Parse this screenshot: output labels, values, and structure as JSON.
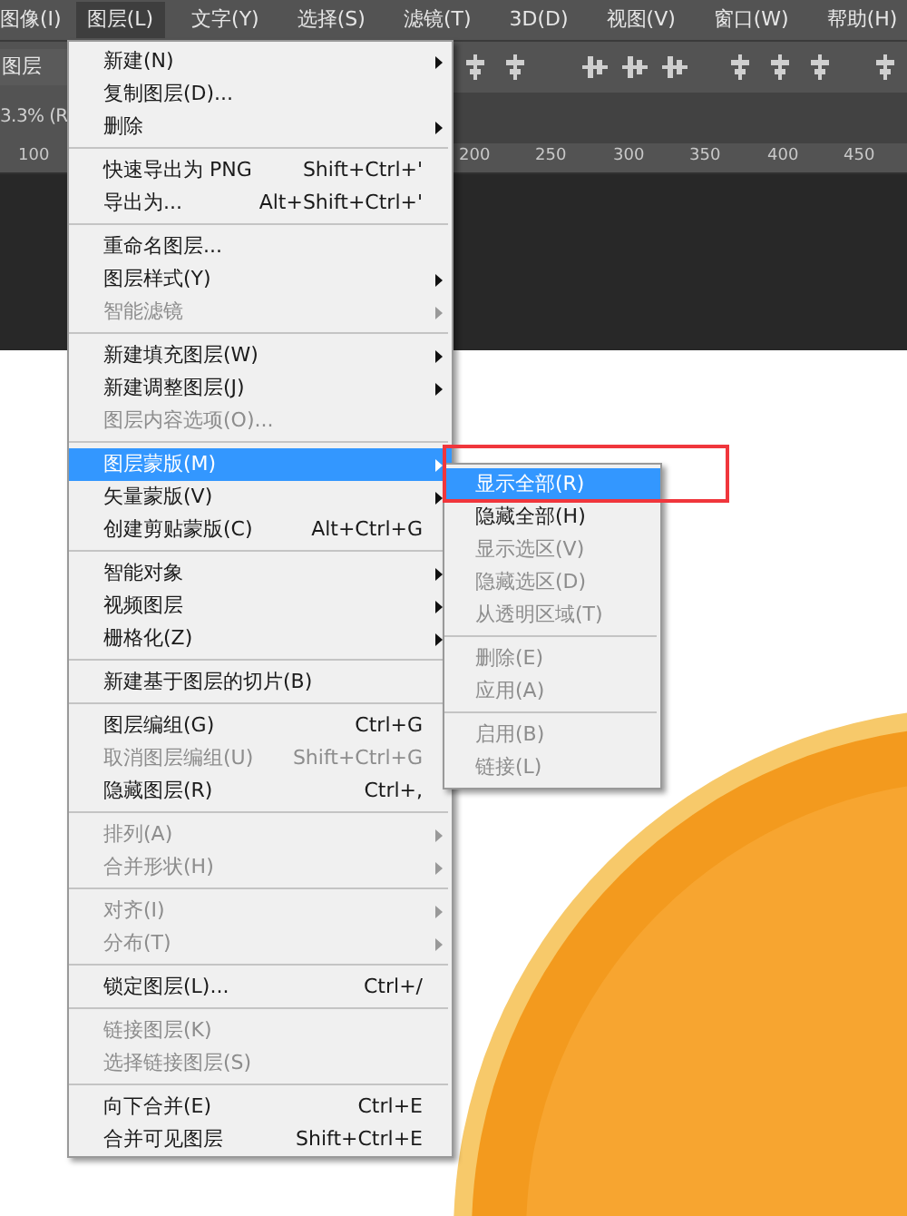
{
  "menubar": [
    {
      "label": "图像(I)",
      "selected": false
    },
    {
      "label": "图层(L)",
      "selected": true
    },
    {
      "label": "文字(Y)",
      "selected": false
    },
    {
      "label": "选择(S)",
      "selected": false
    },
    {
      "label": "滤镜(T)",
      "selected": false
    },
    {
      "label": "3D(D)",
      "selected": false
    },
    {
      "label": "视图(V)",
      "selected": false
    },
    {
      "label": "窗口(W)",
      "selected": false
    },
    {
      "label": "帮助(H)",
      "selected": false
    }
  ],
  "options_bar": {
    "layer_dropdown": "图层"
  },
  "document_tab": {
    "title": "3.3% (R"
  },
  "ruler": {
    "labels": [
      "100",
      "200",
      "250",
      "300",
      "350",
      "400",
      "450"
    ]
  },
  "menu": {
    "items": [
      {
        "kind": "item",
        "label": "新建(N)",
        "submenu": true,
        "disabled": false,
        "selected": false
      },
      {
        "kind": "item",
        "label": "复制图层(D)...",
        "disabled": false,
        "selected": false
      },
      {
        "kind": "item",
        "label": "删除",
        "submenu": true,
        "disabled": false,
        "selected": false
      },
      {
        "kind": "separator"
      },
      {
        "kind": "item",
        "label": "快速导出为 PNG",
        "shortcut": "Shift+Ctrl+'",
        "disabled": false,
        "selected": false
      },
      {
        "kind": "item",
        "label": "导出为...",
        "shortcut": "Alt+Shift+Ctrl+'",
        "disabled": false,
        "selected": false
      },
      {
        "kind": "separator"
      },
      {
        "kind": "item",
        "label": "重命名图层...",
        "disabled": false,
        "selected": false
      },
      {
        "kind": "item",
        "label": "图层样式(Y)",
        "submenu": true,
        "disabled": false,
        "selected": false
      },
      {
        "kind": "item",
        "label": "智能滤镜",
        "submenu": true,
        "disabled": true,
        "selected": false
      },
      {
        "kind": "separator"
      },
      {
        "kind": "item",
        "label": "新建填充图层(W)",
        "submenu": true,
        "disabled": false,
        "selected": false
      },
      {
        "kind": "item",
        "label": "新建调整图层(J)",
        "submenu": true,
        "disabled": false,
        "selected": false
      },
      {
        "kind": "item",
        "label": "图层内容选项(O)...",
        "disabled": true,
        "selected": false
      },
      {
        "kind": "separator"
      },
      {
        "kind": "item",
        "label": "图层蒙版(M)",
        "submenu": true,
        "disabled": false,
        "selected": true
      },
      {
        "kind": "item",
        "label": "矢量蒙版(V)",
        "submenu": true,
        "disabled": false,
        "selected": false
      },
      {
        "kind": "item",
        "label": "创建剪贴蒙版(C)",
        "shortcut": "Alt+Ctrl+G",
        "disabled": false,
        "selected": false
      },
      {
        "kind": "separator"
      },
      {
        "kind": "item",
        "label": "智能对象",
        "submenu": true,
        "disabled": false,
        "selected": false
      },
      {
        "kind": "item",
        "label": "视频图层",
        "submenu": true,
        "disabled": false,
        "selected": false
      },
      {
        "kind": "item",
        "label": "栅格化(Z)",
        "submenu": true,
        "disabled": false,
        "selected": false
      },
      {
        "kind": "separator"
      },
      {
        "kind": "item",
        "label": "新建基于图层的切片(B)",
        "disabled": false,
        "selected": false
      },
      {
        "kind": "separator"
      },
      {
        "kind": "item",
        "label": "图层编组(G)",
        "shortcut": "Ctrl+G",
        "disabled": false,
        "selected": false
      },
      {
        "kind": "item",
        "label": "取消图层编组(U)",
        "shortcut": "Shift+Ctrl+G",
        "disabled": true,
        "selected": false
      },
      {
        "kind": "item",
        "label": "隐藏图层(R)",
        "shortcut": "Ctrl+,",
        "disabled": false,
        "selected": false
      },
      {
        "kind": "separator"
      },
      {
        "kind": "item",
        "label": "排列(A)",
        "submenu": true,
        "disabled": true,
        "selected": false
      },
      {
        "kind": "item",
        "label": "合并形状(H)",
        "submenu": true,
        "disabled": true,
        "selected": false
      },
      {
        "kind": "separator"
      },
      {
        "kind": "item",
        "label": "对齐(I)",
        "submenu": true,
        "disabled": true,
        "selected": false
      },
      {
        "kind": "item",
        "label": "分布(T)",
        "submenu": true,
        "disabled": true,
        "selected": false
      },
      {
        "kind": "separator"
      },
      {
        "kind": "item",
        "label": "锁定图层(L)...",
        "shortcut": "Ctrl+/",
        "disabled": false,
        "selected": false
      },
      {
        "kind": "separator"
      },
      {
        "kind": "item",
        "label": "链接图层(K)",
        "disabled": true,
        "selected": false
      },
      {
        "kind": "item",
        "label": "选择链接图层(S)",
        "disabled": true,
        "selected": false
      },
      {
        "kind": "separator"
      },
      {
        "kind": "item",
        "label": "向下合并(E)",
        "shortcut": "Ctrl+E",
        "disabled": false,
        "selected": false
      },
      {
        "kind": "item",
        "label": "合并可见图层",
        "shortcut": "Shift+Ctrl+E",
        "disabled": false,
        "selected": false
      }
    ]
  },
  "submenu": {
    "items": [
      {
        "kind": "item",
        "label": "显示全部(R)",
        "disabled": false,
        "selected": true
      },
      {
        "kind": "item",
        "label": "隐藏全部(H)",
        "disabled": false,
        "selected": false
      },
      {
        "kind": "item",
        "label": "显示选区(V)",
        "disabled": true,
        "selected": false
      },
      {
        "kind": "item",
        "label": "隐藏选区(D)",
        "disabled": true,
        "selected": false
      },
      {
        "kind": "item",
        "label": "从透明区域(T)",
        "disabled": true,
        "selected": false
      },
      {
        "kind": "separator"
      },
      {
        "kind": "item",
        "label": "删除(E)",
        "disabled": true,
        "selected": false
      },
      {
        "kind": "item",
        "label": "应用(A)",
        "disabled": true,
        "selected": false
      },
      {
        "kind": "separator"
      },
      {
        "kind": "item",
        "label": "启用(B)",
        "disabled": true,
        "selected": false
      },
      {
        "kind": "item",
        "label": "链接(L)",
        "disabled": true,
        "selected": false
      }
    ]
  }
}
